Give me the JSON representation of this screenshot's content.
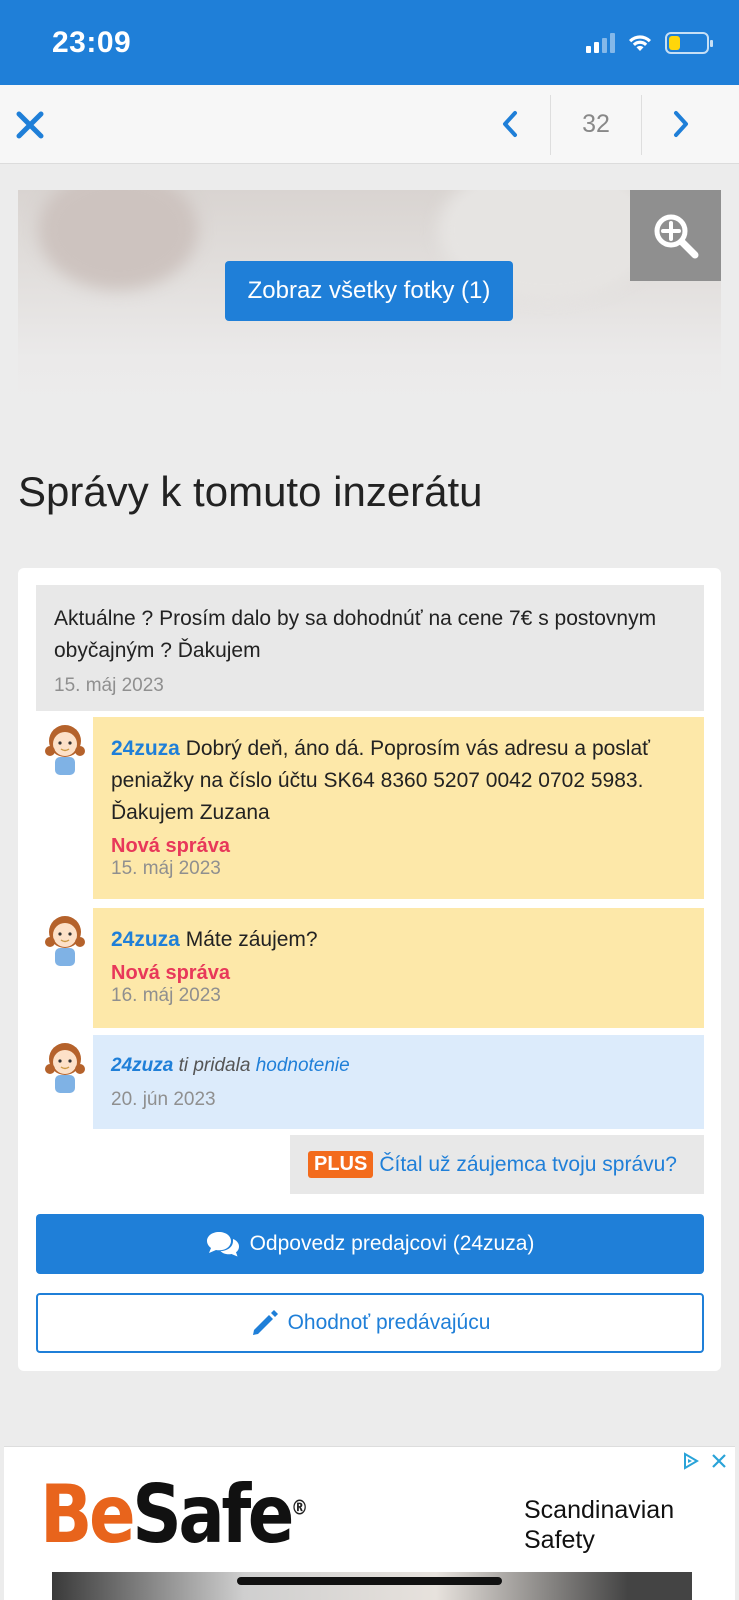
{
  "status_bar": {
    "time": "23:09",
    "icons": [
      "cellular-signal-icon",
      "wifi-icon",
      "battery-icon"
    ],
    "battery_level": 0.3
  },
  "nav": {
    "close_icon": "close-icon",
    "prev_icon": "chevron-left-icon",
    "counter": "32",
    "next_icon": "chevron-right-icon"
  },
  "photo": {
    "show_all_label": "Zobraz všetky fotky (1)",
    "zoom_icon": "zoom-in-icon"
  },
  "section_title": "Správy k tomuto inzerátu",
  "messages": {
    "own": {
      "text": "Aktuálne ? Prosím dalo by sa dohodnúť na cene 7€ s postovnym obyčajným ? Ďakujem",
      "date": "15. máj 2023"
    },
    "replies": [
      {
        "user": "24zuza",
        "text": " Dobrý deň, áno dá. Poprosím vás adresu a poslať peniažky na číslo účtu SK64 8360 5207 0042 0702 5983. Ďakujem Zuzana",
        "status": "Nová správa",
        "date": "15. máj 2023"
      },
      {
        "user": "24zuza",
        "text": " Máte záujem?",
        "status": "Nová správa",
        "date": "16. máj 2023"
      }
    ],
    "rating": {
      "user": "24zuza",
      "text": " ti pridala ",
      "link": "hodnotenie",
      "date": "20. jún 2023"
    }
  },
  "plus": {
    "badge": "PLUS",
    "link": "Čítal už záujemca tvoju správu?"
  },
  "buttons": {
    "reply": "Odpovedz predajcovi (24zuza)",
    "reply_icon": "chat-bubbles-icon",
    "rate": "Ohodnoť predávajúcu",
    "rate_icon": "pencil-icon"
  },
  "ad": {
    "logo_be": "Be",
    "logo_safe": "Safe",
    "logo_reg": "®",
    "tagline_line1": "Scandinavian",
    "tagline_line2": "Safety",
    "icons": [
      "ad-choices-icon",
      "ad-close-icon"
    ]
  },
  "colors": {
    "brand_blue": "#1f7fd8",
    "new_message_red": "#e8385a",
    "reply_yellow": "#fde8a9",
    "rating_blue": "#dcebfb",
    "plus_orange": "#f36b1c"
  }
}
